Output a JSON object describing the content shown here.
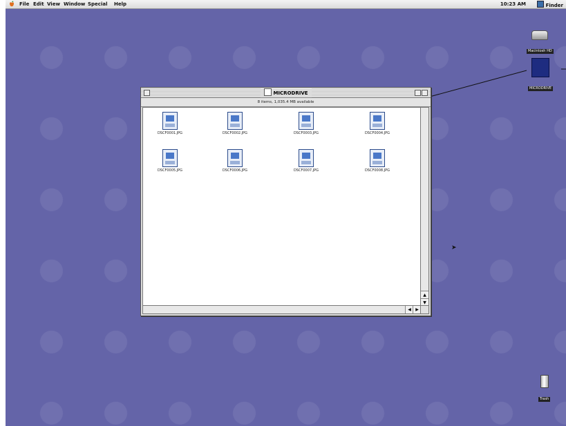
{
  "menubar": {
    "items": [
      "File",
      "Edit",
      "View",
      "Window",
      "Special",
      "Help"
    ],
    "clock": "10:23 AM",
    "app": "Finder"
  },
  "desktop": {
    "icons": [
      {
        "label": "Macintosh HD",
        "type": "hard-disk-icon"
      },
      {
        "label": "MICRODRIVE",
        "type": "removable-disk-icon"
      },
      {
        "label": "Trash",
        "type": "trash-icon"
      }
    ]
  },
  "window": {
    "title": "MICRODRIVE",
    "info": "8 items, 1,035.4 MB available",
    "files": [
      "DSCF0001.JPG",
      "DSCF0002.JPG",
      "DSCF0003.JPG",
      "DSCF0004.JPG",
      "DSCF0005.JPG",
      "DSCF0006.JPG",
      "DSCF0007.JPG",
      "DSCF0008.JPG"
    ]
  },
  "colors": {
    "desktop": "#6464a8",
    "accent": "#1e2c80"
  }
}
